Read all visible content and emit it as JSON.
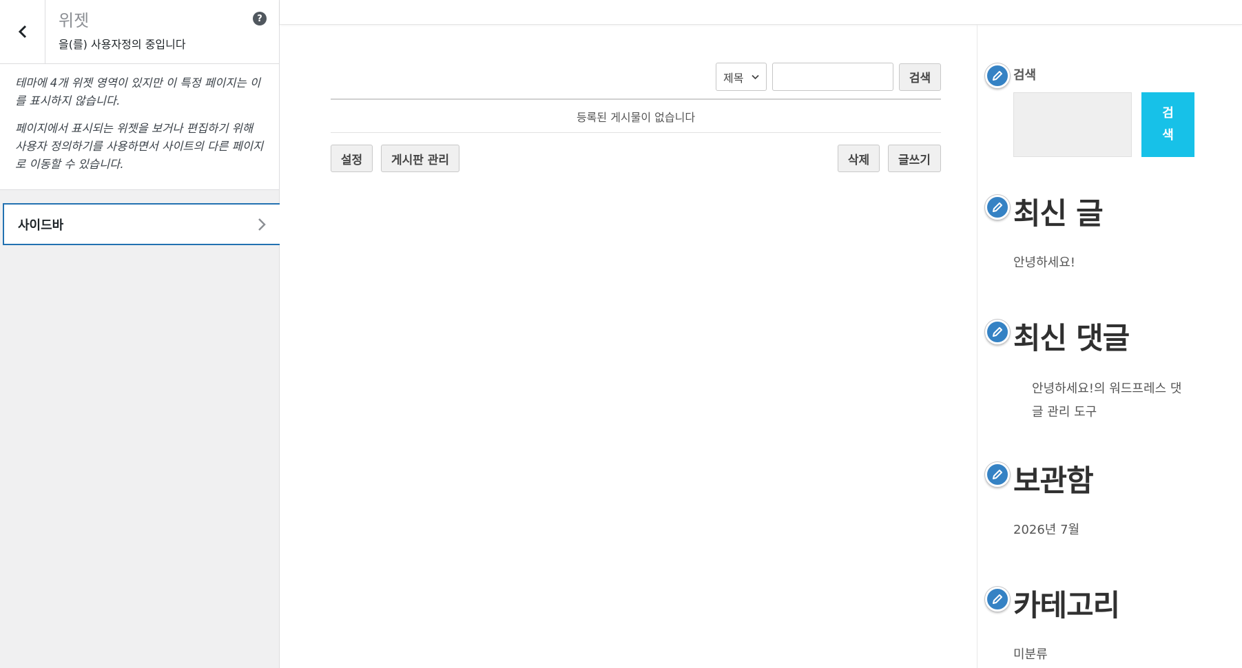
{
  "customizer": {
    "title": "위젯",
    "subtitle": "을(를) 사용자정의 중입니다",
    "help_symbol": "?",
    "description": [
      "테마에 4개 위젯 영역이 있지만 이 특정 페이지는 이를 표시하지 않습니다.",
      "페이지에서 표시되는 위젯을 보거나 편집하기 위해 사용자 정의하기를 사용하면서 사이트의 다른 페이지로 이동할 수 있습니다."
    ],
    "sections": [
      {
        "label": "사이드바"
      }
    ],
    "accent_color": "#2271b1"
  },
  "board": {
    "search_select": "제목",
    "search_button": "검색",
    "empty_message": "등록된 게시물이 없습니다",
    "buttons": {
      "settings": "설정",
      "manage": "게시판 관리",
      "delete": "삭제",
      "write": "글쓰기"
    }
  },
  "widgets": {
    "search": {
      "title": "검색",
      "button_line1": "검",
      "button_line2": "색",
      "button_color": "#17c1e8"
    },
    "recent_posts": {
      "title": "최신 글",
      "items": [
        "안녕하세요!"
      ]
    },
    "recent_comments": {
      "title": "최신 댓글",
      "line1": "안녕하세요!의 워드프레스 댓",
      "line2": "글 관리 도구"
    },
    "archives": {
      "title": "보관함",
      "items": [
        "2026년 7월"
      ]
    },
    "categories": {
      "title": "카테고리",
      "items": [
        "미분류"
      ]
    },
    "edit_icon_color": "#3582c4"
  }
}
